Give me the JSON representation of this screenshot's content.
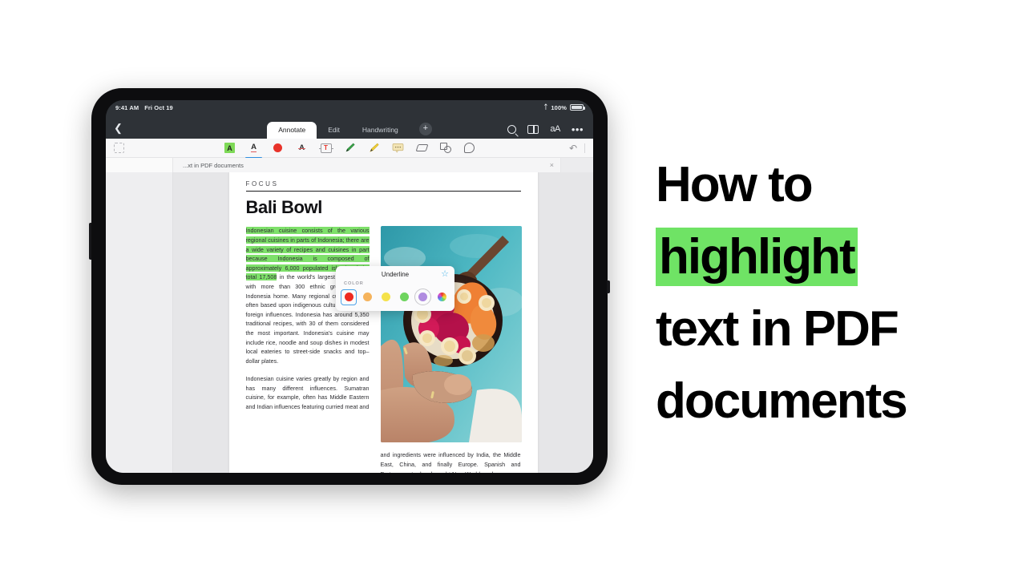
{
  "device": {
    "status": {
      "time": "9:41 AM",
      "date": "Fri Oct 19",
      "bluetooth_icon": "bluetooth-icon",
      "battery_pct": "100%"
    },
    "nav": {
      "back_icon": "chevron-left-icon",
      "grid_icon": "grid-icon",
      "tabs": [
        {
          "label": "Annotate",
          "active": true
        },
        {
          "label": "Edit",
          "active": false
        },
        {
          "label": "Handwriting",
          "active": false
        }
      ],
      "add_label": "+",
      "right_icons": [
        "search-icon",
        "book-icon",
        "text-size-icon",
        "more-icon"
      ],
      "text_size_label": "aA",
      "more_label": "•••"
    },
    "toolbar": {
      "select_icon": "dashed-select-icon",
      "tools": [
        {
          "name": "highlight-tool",
          "glyph": "A",
          "selected": false
        },
        {
          "name": "underline-tool",
          "glyph": "A",
          "selected": true
        },
        {
          "name": "color-dot-tool",
          "glyph": "",
          "selected": false
        },
        {
          "name": "strikethrough-tool",
          "glyph": "A",
          "selected": false
        },
        {
          "name": "text-box-tool",
          "glyph": "T",
          "selected": false
        },
        {
          "name": "pen-tool",
          "glyph": "",
          "selected": false
        },
        {
          "name": "marker-tool",
          "glyph": "",
          "selected": false
        },
        {
          "name": "note-tool",
          "glyph": "",
          "selected": false
        },
        {
          "name": "eraser-tool",
          "glyph": "",
          "selected": false
        },
        {
          "name": "shapes-tool",
          "glyph": "",
          "selected": false
        },
        {
          "name": "stamp-tool",
          "glyph": "",
          "selected": false
        }
      ],
      "undo_icon": "undo-icon"
    },
    "doctab": {
      "title": "...xt in PDF documents",
      "close_label": "×"
    },
    "popup": {
      "title": "Underline",
      "star_icon": "star-icon",
      "color_label": "COLOR",
      "swatches": [
        {
          "name": "red",
          "hex": "#ee2b22",
          "state": "selected-box"
        },
        {
          "name": "orange",
          "hex": "#f5b35c",
          "state": "none"
        },
        {
          "name": "yellow",
          "hex": "#f5e24a",
          "state": "none"
        },
        {
          "name": "green",
          "hex": "#6ed45e",
          "state": "none"
        },
        {
          "name": "purple",
          "hex": "#b08ce0",
          "state": "selected-ring"
        },
        {
          "name": "rainbow",
          "hex": "rainbow",
          "state": "none"
        }
      ]
    },
    "document": {
      "kicker": "FOCUS",
      "headline": "Bali Bowl",
      "paragraph1_highlighted": "Indonesian cuisine consists of the various regional cuisines in parts of Indonesia; there are a wide variety of recipes and cuisines in part because Indonesia is composed of approximately 6,000 populated islands of the total 17,508",
      "paragraph1_rest": " in the world's largest archipelago, with more than 300 ethnic groups calling Indonesia home. Many regional cuisines exist, often based upon indigenous culture with some foreign influences. Indonesia has around 5,350 traditional recipes, with 30 of them considered the most important. Indonesia's cuisine may include rice, noodle and soup dishes in modest local eateries to street-side snacks and top–dollar plates.",
      "paragraph2": "Indonesian cuisine varies greatly by region and has many different influences. Sumatran cuisine, for example, often has Middle Eastern and Indian influences featuring curried meat and",
      "photo_alt": "smoothie-bowl-photo",
      "paragraph3": "and ingredients were influenced by India, the Middle East, China, and finally Europe. Spanish and Portuguese traders brought New World produce"
    }
  },
  "right_panel": {
    "line1": "How to",
    "line2_highlighted": "highlight",
    "line3": "text in PDF",
    "line4": "documents",
    "highlight_color": "#6fe365"
  }
}
